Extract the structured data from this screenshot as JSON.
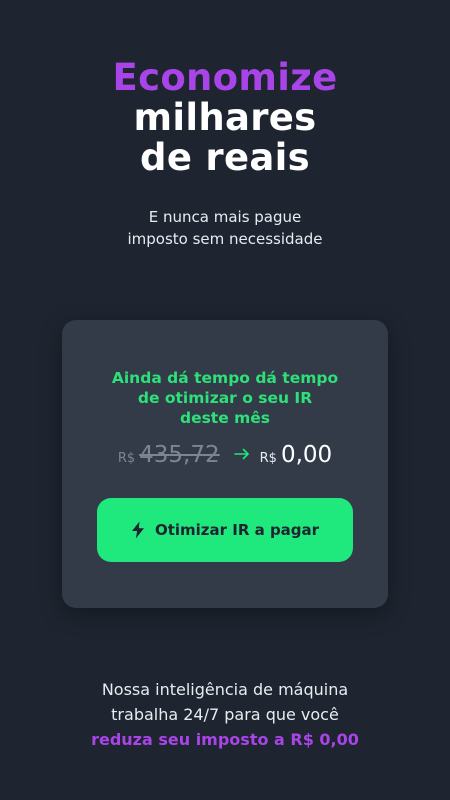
{
  "hero": {
    "title_accent": "Economize",
    "title_line2": "milhares",
    "title_line3": "de reais",
    "subtitle_line1": "E nunca mais pague",
    "subtitle_line2": "imposto sem necessidade"
  },
  "card": {
    "title_line1": "Ainda dá tempo dá tempo",
    "title_line2": "de otimizar o seu IR",
    "title_line3": "deste mês",
    "old_currency": "R$",
    "old_value": "435,72",
    "new_currency": "R$",
    "new_value": "0,00",
    "arrow_icon": "arrow-right-icon",
    "cta_icon": "lightning-bolt-icon",
    "cta_label": "Otimizar IR a pagar"
  },
  "footer": {
    "line1": "Nossa inteligência de máquina",
    "line2": "trabalha 24/7 para que você",
    "highlight": "reduza seu imposto a R$ 0,00"
  },
  "colors": {
    "background": "#1e2530",
    "card": "#323b47",
    "accent_purple": "#a844e8",
    "accent_green": "#1fe87c",
    "card_title_green": "#2ee07a"
  }
}
